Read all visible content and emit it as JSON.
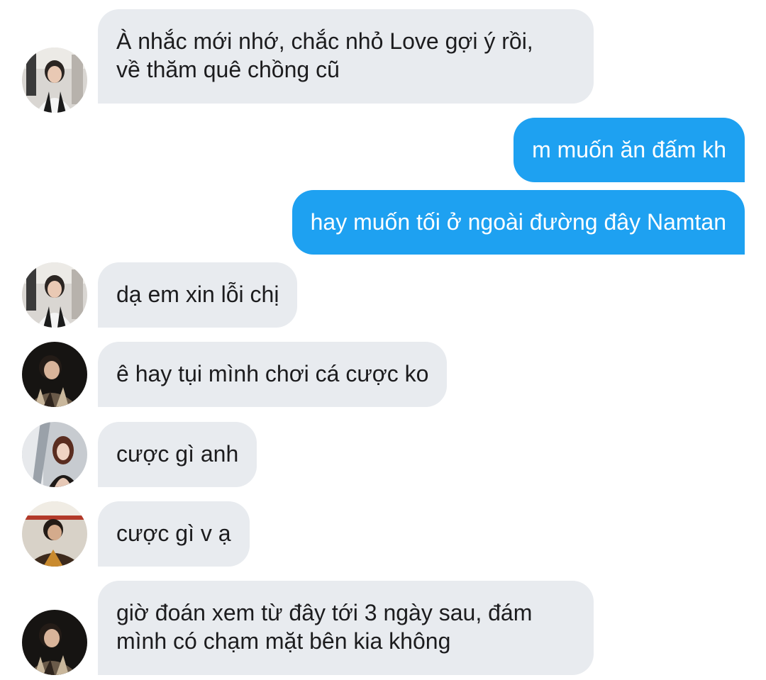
{
  "conversation": {
    "colors": {
      "incoming_bubble": "#e8ebef",
      "outgoing_bubble": "#1ea1f1",
      "incoming_text": "#1c1c1e",
      "outgoing_text": "#ffffff"
    },
    "messages": [
      {
        "direction": "incoming",
        "sender_avatar": "avatar-sender-a",
        "lines": [
          "À nhắc mới nhớ, chắc nhỏ Love gợi ý rồi,",
          "về thăm quê chồng cũ"
        ]
      },
      {
        "direction": "outgoing",
        "lines": [
          "m muốn ăn đấm kh"
        ]
      },
      {
        "direction": "outgoing",
        "lines": [
          "hay muốn tối ở ngoài đường đây Namtan"
        ]
      },
      {
        "direction": "incoming",
        "sender_avatar": "avatar-sender-a",
        "lines": [
          "dạ em xin lỗi chị"
        ]
      },
      {
        "direction": "incoming",
        "sender_avatar": "avatar-sender-b",
        "lines": [
          "ê hay tụi mình chơi cá cược ko"
        ]
      },
      {
        "direction": "incoming",
        "sender_avatar": "avatar-sender-c",
        "lines": [
          "cược gì anh"
        ]
      },
      {
        "direction": "incoming",
        "sender_avatar": "avatar-sender-d",
        "lines": [
          "cược gì v ạ"
        ]
      },
      {
        "direction": "incoming",
        "sender_avatar": "avatar-sender-b",
        "lines": [
          "giờ đoán xem từ đây tới 3 ngày sau, đám",
          "mình có chạm mặt bên kia không"
        ]
      }
    ]
  }
}
